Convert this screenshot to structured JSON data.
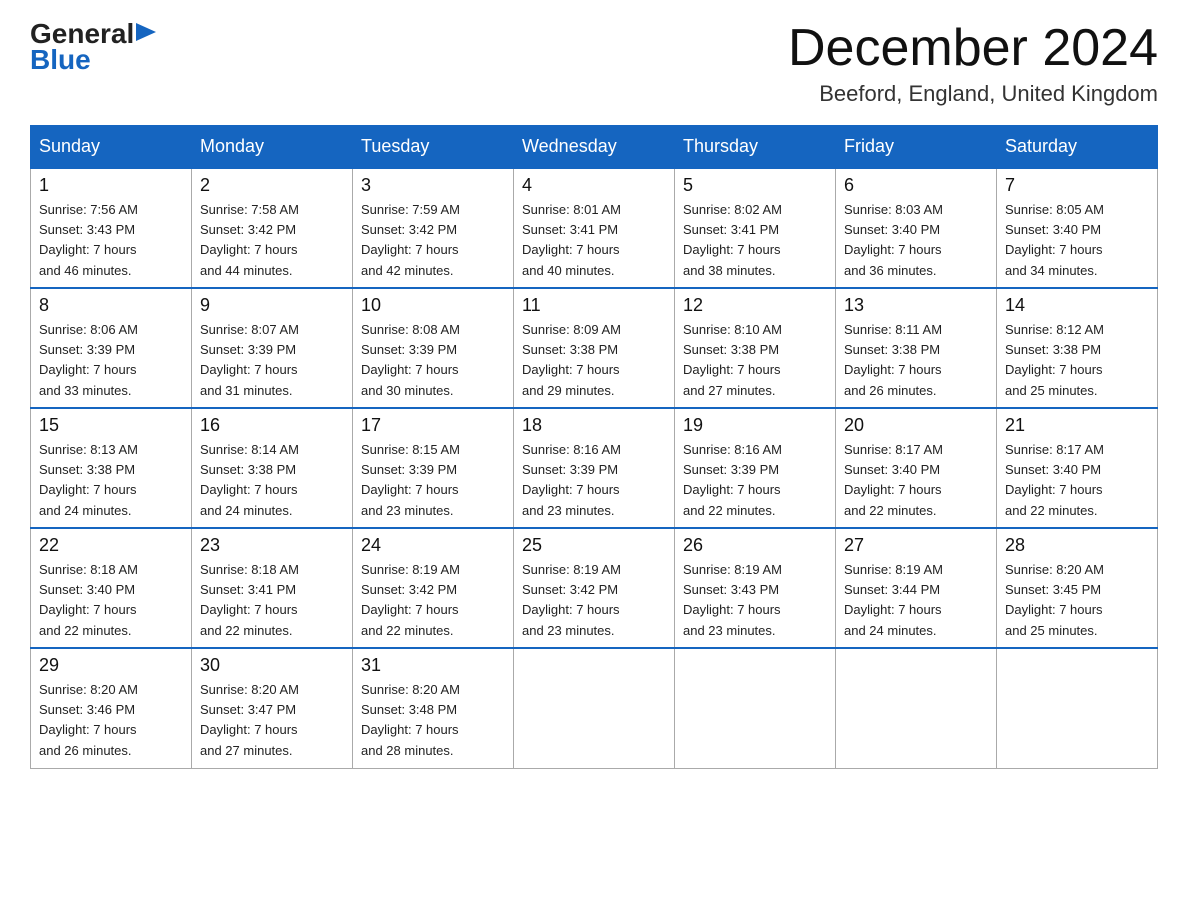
{
  "logo": {
    "general": "General",
    "blue": "Blue",
    "arrow": "▶"
  },
  "header": {
    "month": "December 2024",
    "location": "Beeford, England, United Kingdom"
  },
  "weekdays": [
    "Sunday",
    "Monday",
    "Tuesday",
    "Wednesday",
    "Thursday",
    "Friday",
    "Saturday"
  ],
  "weeks": [
    [
      {
        "day": "1",
        "sunrise": "7:56 AM",
        "sunset": "3:43 PM",
        "daylight": "7 hours and 46 minutes."
      },
      {
        "day": "2",
        "sunrise": "7:58 AM",
        "sunset": "3:42 PM",
        "daylight": "7 hours and 44 minutes."
      },
      {
        "day": "3",
        "sunrise": "7:59 AM",
        "sunset": "3:42 PM",
        "daylight": "7 hours and 42 minutes."
      },
      {
        "day": "4",
        "sunrise": "8:01 AM",
        "sunset": "3:41 PM",
        "daylight": "7 hours and 40 minutes."
      },
      {
        "day": "5",
        "sunrise": "8:02 AM",
        "sunset": "3:41 PM",
        "daylight": "7 hours and 38 minutes."
      },
      {
        "day": "6",
        "sunrise": "8:03 AM",
        "sunset": "3:40 PM",
        "daylight": "7 hours and 36 minutes."
      },
      {
        "day": "7",
        "sunrise": "8:05 AM",
        "sunset": "3:40 PM",
        "daylight": "7 hours and 34 minutes."
      }
    ],
    [
      {
        "day": "8",
        "sunrise": "8:06 AM",
        "sunset": "3:39 PM",
        "daylight": "7 hours and 33 minutes."
      },
      {
        "day": "9",
        "sunrise": "8:07 AM",
        "sunset": "3:39 PM",
        "daylight": "7 hours and 31 minutes."
      },
      {
        "day": "10",
        "sunrise": "8:08 AM",
        "sunset": "3:39 PM",
        "daylight": "7 hours and 30 minutes."
      },
      {
        "day": "11",
        "sunrise": "8:09 AM",
        "sunset": "3:38 PM",
        "daylight": "7 hours and 29 minutes."
      },
      {
        "day": "12",
        "sunrise": "8:10 AM",
        "sunset": "3:38 PM",
        "daylight": "7 hours and 27 minutes."
      },
      {
        "day": "13",
        "sunrise": "8:11 AM",
        "sunset": "3:38 PM",
        "daylight": "7 hours and 26 minutes."
      },
      {
        "day": "14",
        "sunrise": "8:12 AM",
        "sunset": "3:38 PM",
        "daylight": "7 hours and 25 minutes."
      }
    ],
    [
      {
        "day": "15",
        "sunrise": "8:13 AM",
        "sunset": "3:38 PM",
        "daylight": "7 hours and 24 minutes."
      },
      {
        "day": "16",
        "sunrise": "8:14 AM",
        "sunset": "3:38 PM",
        "daylight": "7 hours and 24 minutes."
      },
      {
        "day": "17",
        "sunrise": "8:15 AM",
        "sunset": "3:39 PM",
        "daylight": "7 hours and 23 minutes."
      },
      {
        "day": "18",
        "sunrise": "8:16 AM",
        "sunset": "3:39 PM",
        "daylight": "7 hours and 23 minutes."
      },
      {
        "day": "19",
        "sunrise": "8:16 AM",
        "sunset": "3:39 PM",
        "daylight": "7 hours and 22 minutes."
      },
      {
        "day": "20",
        "sunrise": "8:17 AM",
        "sunset": "3:40 PM",
        "daylight": "7 hours and 22 minutes."
      },
      {
        "day": "21",
        "sunrise": "8:17 AM",
        "sunset": "3:40 PM",
        "daylight": "7 hours and 22 minutes."
      }
    ],
    [
      {
        "day": "22",
        "sunrise": "8:18 AM",
        "sunset": "3:40 PM",
        "daylight": "7 hours and 22 minutes."
      },
      {
        "day": "23",
        "sunrise": "8:18 AM",
        "sunset": "3:41 PM",
        "daylight": "7 hours and 22 minutes."
      },
      {
        "day": "24",
        "sunrise": "8:19 AM",
        "sunset": "3:42 PM",
        "daylight": "7 hours and 22 minutes."
      },
      {
        "day": "25",
        "sunrise": "8:19 AM",
        "sunset": "3:42 PM",
        "daylight": "7 hours and 23 minutes."
      },
      {
        "day": "26",
        "sunrise": "8:19 AM",
        "sunset": "3:43 PM",
        "daylight": "7 hours and 23 minutes."
      },
      {
        "day": "27",
        "sunrise": "8:19 AM",
        "sunset": "3:44 PM",
        "daylight": "7 hours and 24 minutes."
      },
      {
        "day": "28",
        "sunrise": "8:20 AM",
        "sunset": "3:45 PM",
        "daylight": "7 hours and 25 minutes."
      }
    ],
    [
      {
        "day": "29",
        "sunrise": "8:20 AM",
        "sunset": "3:46 PM",
        "daylight": "7 hours and 26 minutes."
      },
      {
        "day": "30",
        "sunrise": "8:20 AM",
        "sunset": "3:47 PM",
        "daylight": "7 hours and 27 minutes."
      },
      {
        "day": "31",
        "sunrise": "8:20 AM",
        "sunset": "3:48 PM",
        "daylight": "7 hours and 28 minutes."
      },
      null,
      null,
      null,
      null
    ]
  ]
}
